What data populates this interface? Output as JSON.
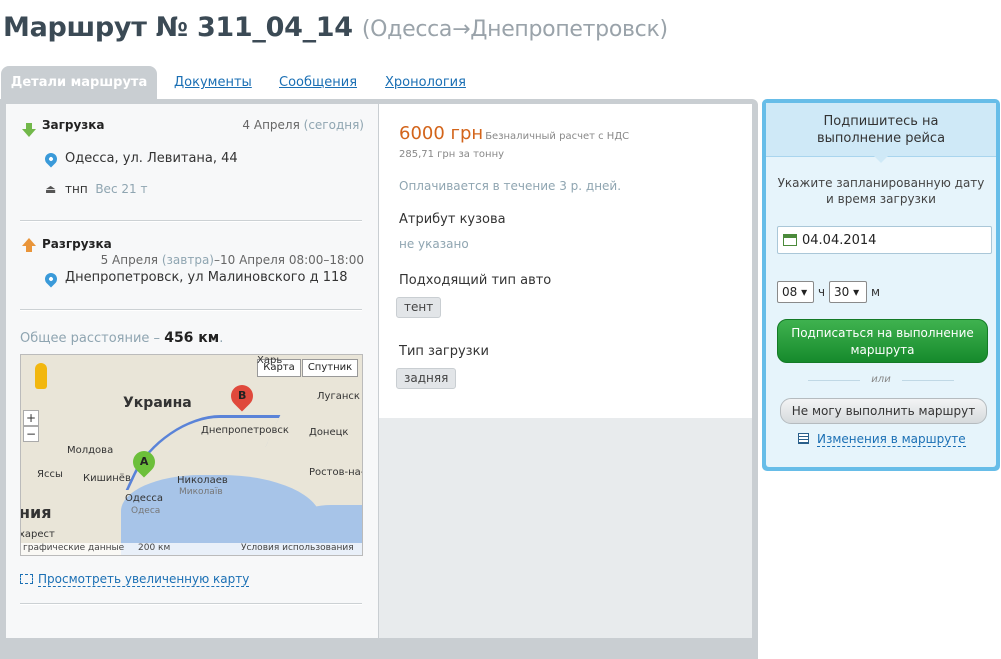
{
  "title": {
    "main": "Маршрут № 311_04_14",
    "route": "(Одесса→Днепропетровск)"
  },
  "tabs": [
    {
      "label": "Детали маршрута",
      "active": true
    },
    {
      "label": "Документы"
    },
    {
      "label": "Сообщения"
    },
    {
      "label": "Хронология"
    }
  ],
  "loading": {
    "heading": "Загрузка",
    "date": "4 Апреля",
    "date_note": "(сегодня)",
    "address": "Одесса, ул. Левитана, 44",
    "cargo": "тнп",
    "weight": "Вес 21 т"
  },
  "unloading": {
    "heading": "Разгрузка",
    "date_start": "5 Апреля",
    "date_start_note": "(завтра)",
    "date_end": "–10 Апреля 08:00–18:00",
    "address": "Днепропетровск, ул Малиновского д 118"
  },
  "distance": {
    "label": "Общее расстояние –",
    "value": "456 км",
    "suffix": "."
  },
  "map": {
    "btn_map": "Карта",
    "btn_satellite": "Спутник",
    "zoom_in": "+",
    "zoom_out": "−",
    "marker_a": "A",
    "marker_b": "B",
    "labels": {
      "ukraine": "Украина",
      "kharkiv": "Харь",
      "lugansk": "Луганск",
      "dnepr": "Днепропетровск",
      "donetsk": "Донецк",
      "moldova": "Молдова",
      "yassy": "Яссы",
      "kishinev": "Кишинёв",
      "odessa": "Одесса",
      "odessa_ru": "Одеса",
      "nikolaev": "Николаев",
      "mikolaiv": "Миколаїв",
      "rostov": "Ростов-на-",
      "romania": "ния",
      "bucharest": "харест"
    },
    "footer": {
      "data": "графические данные",
      "scale": "200 км",
      "terms": "Условия использования"
    }
  },
  "enlarge_link": "Просмотреть увеличенную карту",
  "price": {
    "value": "6000 грн",
    "note": "Безналичный расчет с НДС",
    "per_ton": "285,71 грн за тонну",
    "payment": "Оплачивается в течение 3 р. дней."
  },
  "attributes": {
    "body_label": "Атрибут кузова",
    "body_value": "не указано",
    "vehicle_label": "Подходящий тип авто",
    "vehicle_tag": "тент",
    "loading_label": "Тип загрузки",
    "loading_tag": "задняя"
  },
  "sidebar": {
    "title": "Подпишитесь на выполнение рейса",
    "hint": "Укажите запланированную дату и время загрузки",
    "date_value": "04.04.2014",
    "hour": "08",
    "hour_label": "ч",
    "minute": "30",
    "minute_label": "м",
    "subscribe_btn": "Подписаться на выполнение маршрута",
    "or": "или",
    "decline_btn": "Не могу выполнить маршрут",
    "changes_link": "Изменения в маршруте"
  },
  "colors": {
    "accent": "#1a6fb4",
    "price": "#d3641a",
    "green": "#1f9a36",
    "side_border": "#67bde8"
  }
}
